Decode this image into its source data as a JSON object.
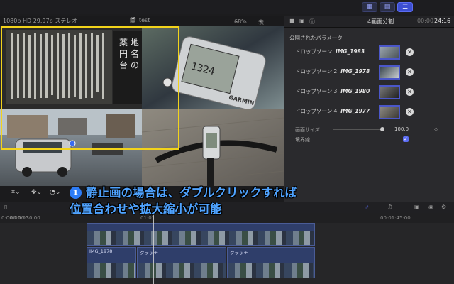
{
  "viewer": {
    "format": "1080p HD 29.97p ステレオ",
    "project": "test",
    "zoom": "68%",
    "view_menu": "表示",
    "thumb_text_top": "1324"
  },
  "inspector": {
    "title": "4画面分割",
    "timecode_prefix": "00:00",
    "timecode": "24:16",
    "params_title": "公開されたパラメータ",
    "drop_zones": [
      {
        "label": "ドロップゾーン:",
        "clip": "IMG_1983"
      },
      {
        "label": "ドロップゾーン 2:",
        "clip": "IMG_1978"
      },
      {
        "label": "ドロップゾーン 3:",
        "clip": "IMG_1980"
      },
      {
        "label": "ドロップゾーン 4:",
        "clip": "IMG_1977"
      }
    ],
    "screen_size_label": "画面サイズ",
    "screen_size_value": "100.0",
    "border_label": "境界線"
  },
  "timeline": {
    "ruler": [
      "0:00:00:00",
      "00:00:30:00",
      "01:01",
      "00:01:45:00"
    ],
    "clips": [
      {
        "label": ""
      },
      {
        "label": "IMG_1978"
      },
      {
        "label": "クラッチ"
      },
      {
        "label": "クラッチ"
      }
    ]
  },
  "caption": {
    "number": "1",
    "line1": "静止画の場合は、ダブルクリックすれば",
    "line2": "位置合わせや拡大縮小が可能"
  },
  "colors": {
    "accent": "#4b57c9",
    "selection": "#f2d31b",
    "caption": "#4fa3ff"
  }
}
